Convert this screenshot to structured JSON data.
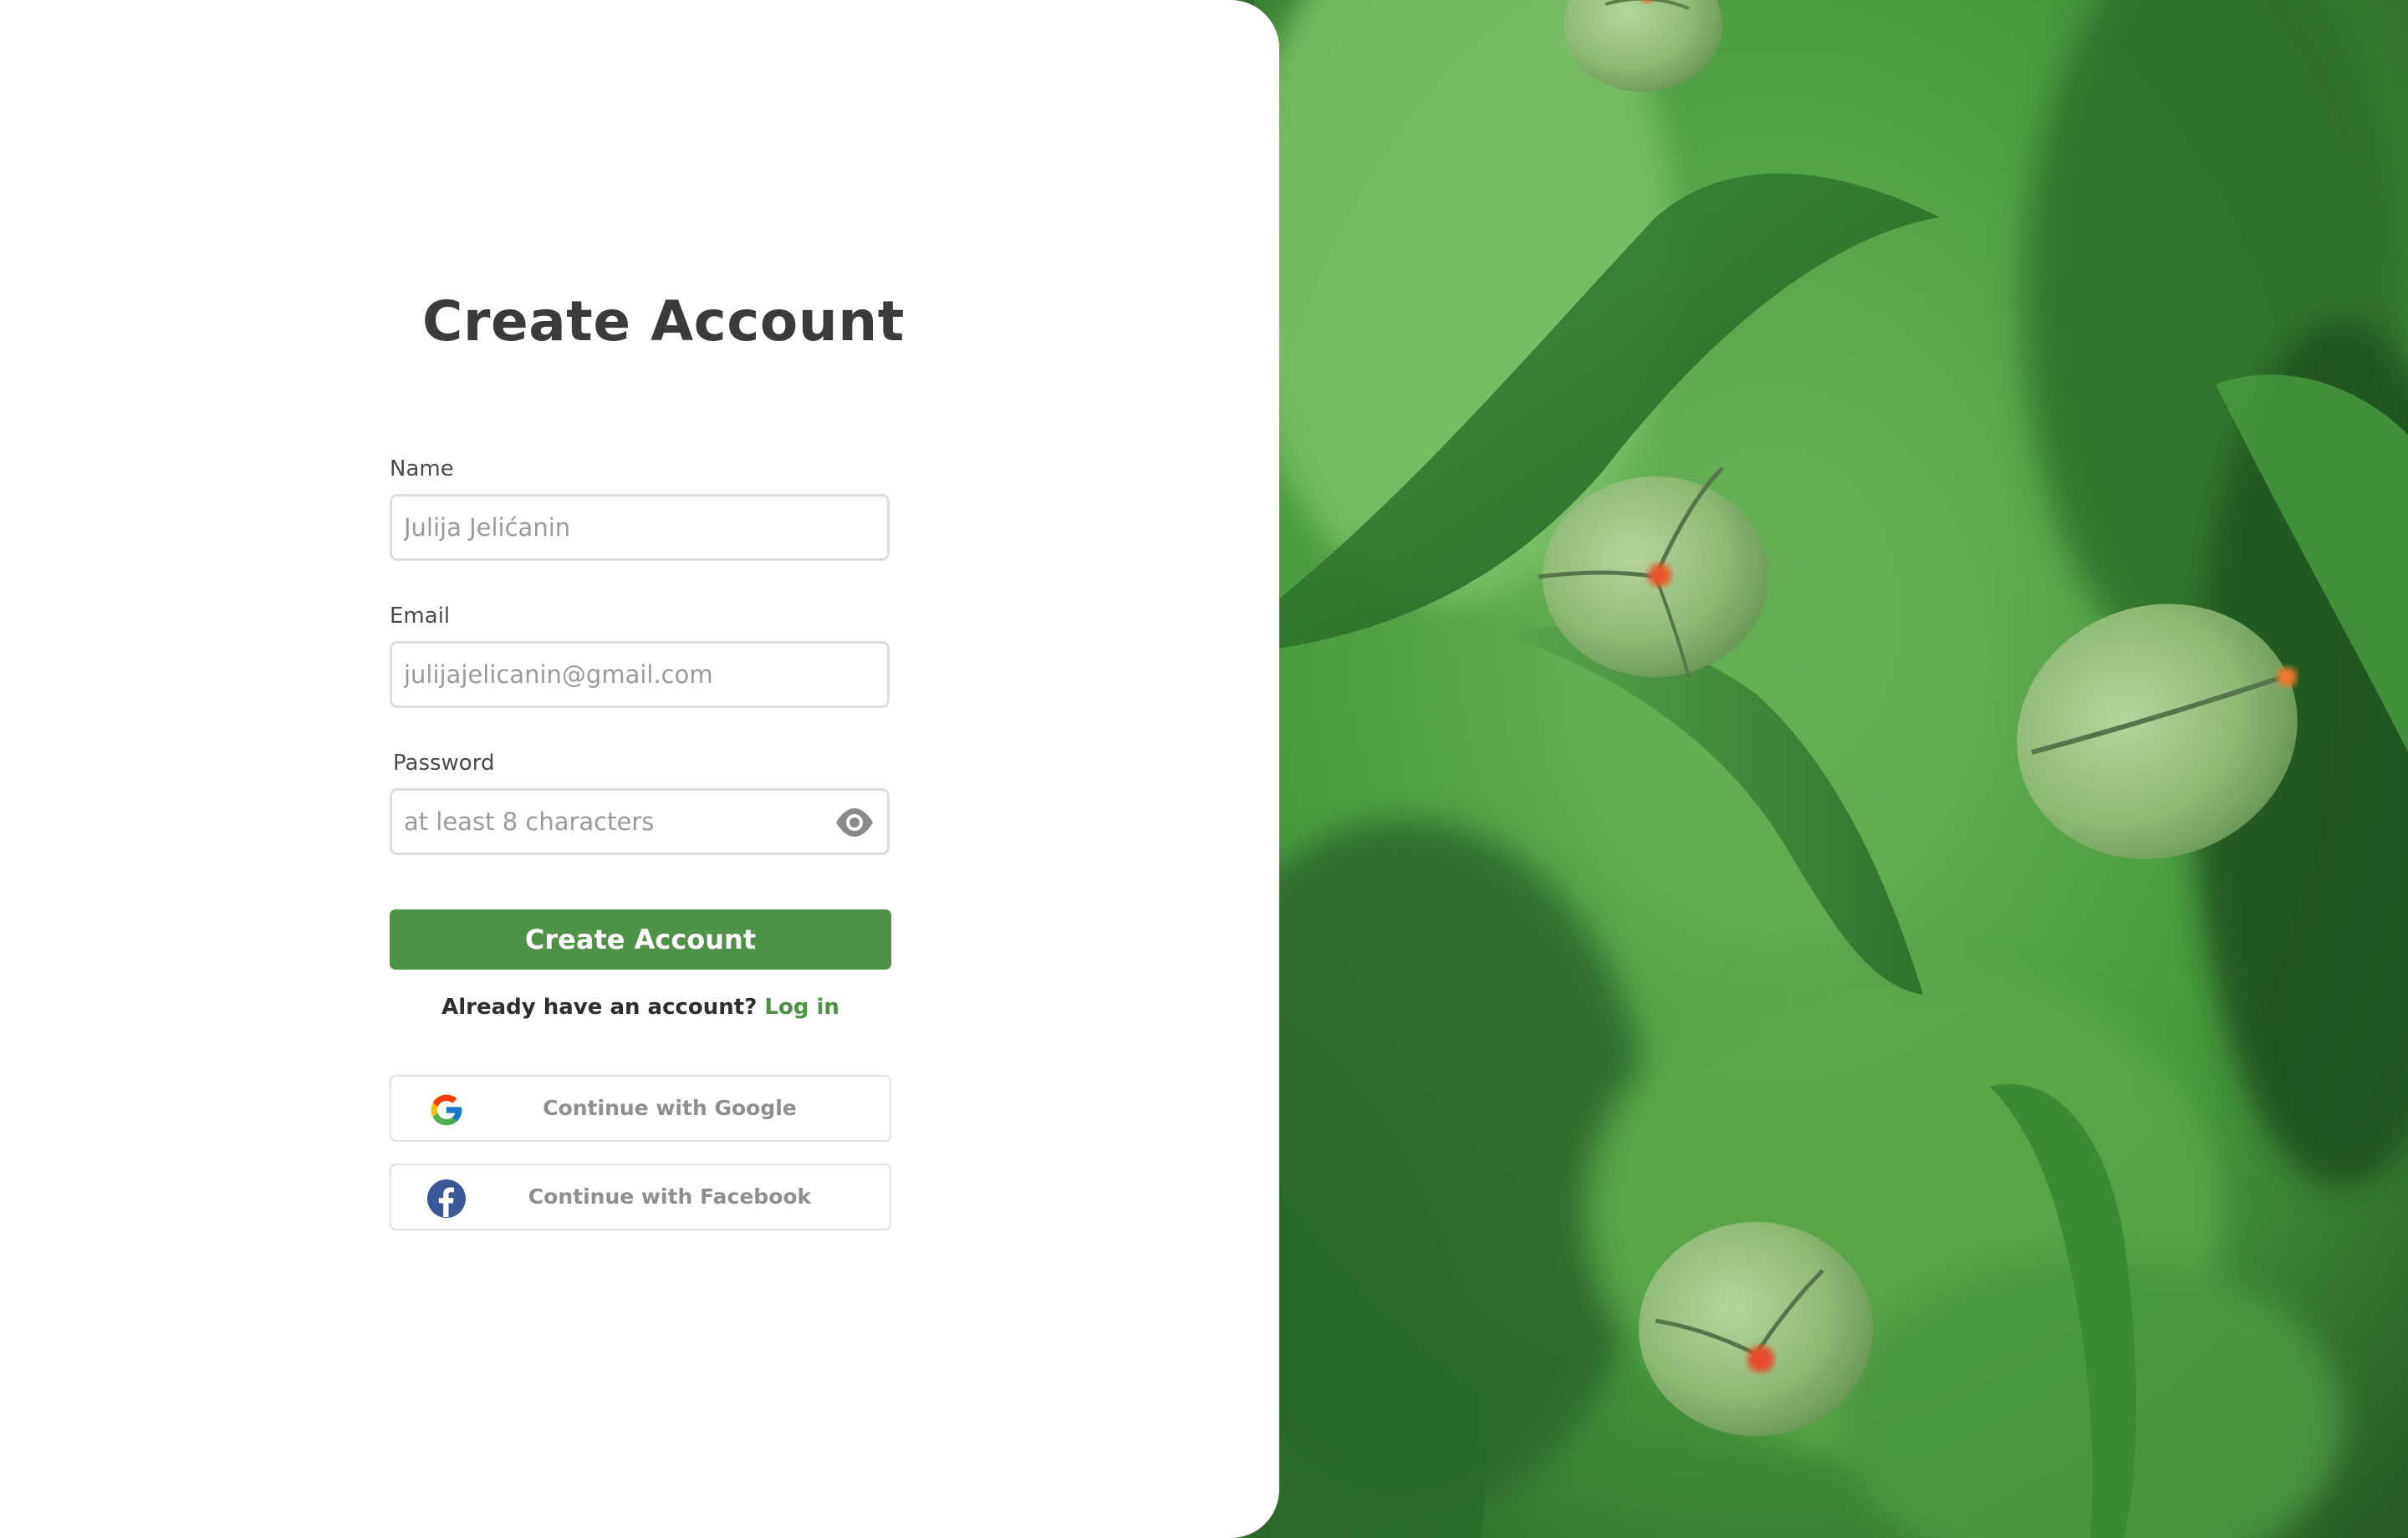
{
  "page": {
    "title": "Create Account"
  },
  "form": {
    "name": {
      "label": "Name",
      "value": "",
      "placeholder": "Julija Jelićanin"
    },
    "email": {
      "label": "Email",
      "value": "",
      "placeholder": "julijajelicanin@gmail.com"
    },
    "password": {
      "label": "Password",
      "value": "",
      "placeholder": "at least 8 characters",
      "toggle_icon": "eye-icon"
    },
    "submit_label": "Create Account"
  },
  "login_prompt": {
    "text": "Already have an account?",
    "link": "Log in"
  },
  "social": {
    "google": {
      "label": "Continue with Google",
      "icon": "google-icon"
    },
    "facebook": {
      "label": "Continue with Facebook",
      "icon": "facebook-icon"
    }
  },
  "colors": {
    "accent": "#4e9247",
    "link": "#4a9140",
    "title": "#3b3b3b",
    "hero_base": "#3f8a3a"
  },
  "hero": {
    "image": "green-tulip-buds-photo"
  }
}
